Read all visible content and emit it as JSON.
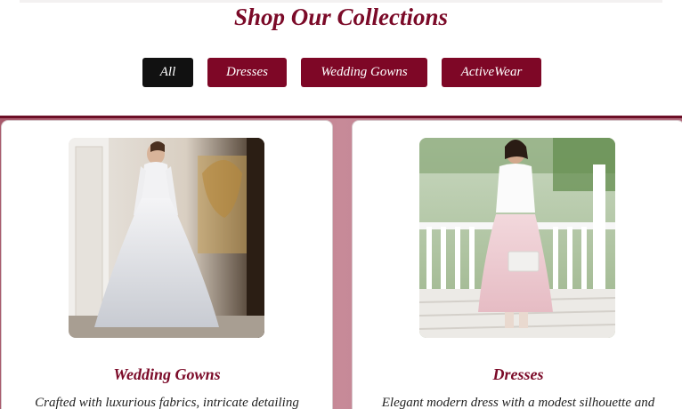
{
  "header": {
    "title": "Shop Our Collections"
  },
  "filters": [
    {
      "label": "All",
      "active": true
    },
    {
      "label": "Dresses",
      "active": false
    },
    {
      "label": "Wedding Gowns",
      "active": false
    },
    {
      "label": "ActiveWear",
      "active": false
    }
  ],
  "products": [
    {
      "title": "Wedding Gowns",
      "description": "Crafted with luxurious fabrics, intricate detailing",
      "image": "bride-in-white-gown-photo"
    },
    {
      "title": "Dresses",
      "description": "Elegant modern dress with a modest silhouette and",
      "image": "woman-in-lace-skirt-photo"
    }
  ],
  "colors": {
    "brand": "#7e0726",
    "active_filter": "#111111",
    "grid_background": "#c78a98"
  }
}
